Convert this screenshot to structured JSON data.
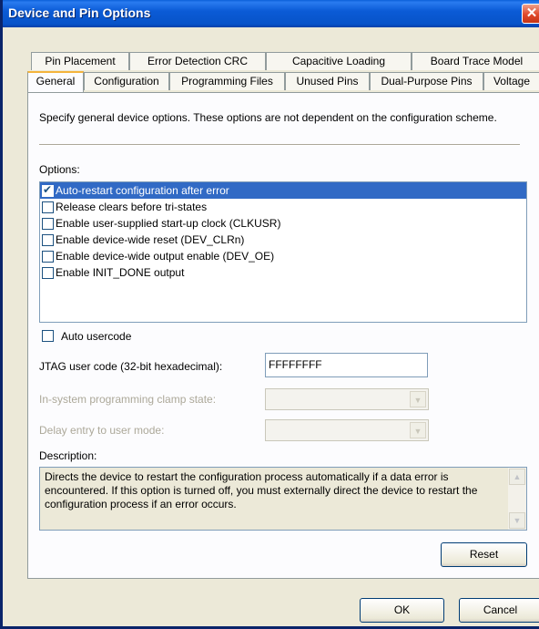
{
  "window": {
    "title": "Device and Pin Options",
    "close_glyph": "✕"
  },
  "tabs_back": [
    "Pin Placement",
    "Error Detection CRC",
    "Capacitive Loading",
    "Board Trace Model"
  ],
  "tabs_front": [
    "General",
    "Configuration",
    "Programming Files",
    "Unused Pins",
    "Dual-Purpose Pins",
    "Voltage"
  ],
  "active_tab": "General",
  "general": {
    "intro": "Specify general device options. These options are not dependent on the configuration scheme.",
    "options_label": "Options:",
    "options": [
      {
        "label": "Auto-restart configuration after error",
        "checked": true,
        "selected": true
      },
      {
        "label": "Release clears before tri-states",
        "checked": false,
        "selected": false
      },
      {
        "label": "Enable user-supplied start-up clock (CLKUSR)",
        "checked": false,
        "selected": false
      },
      {
        "label": "Enable device-wide reset (DEV_CLRn)",
        "checked": false,
        "selected": false
      },
      {
        "label": "Enable device-wide output enable (DEV_OE)",
        "checked": false,
        "selected": false
      },
      {
        "label": "Enable INIT_DONE output",
        "checked": false,
        "selected": false
      }
    ],
    "auto_usercode_label": "Auto usercode",
    "auto_usercode_checked": false,
    "jtag_label": "JTAG user code (32-bit hexadecimal):",
    "jtag_value": "FFFFFFFF",
    "isp_clamp_label": "In-system programming clamp state:",
    "isp_clamp_value": "",
    "delay_entry_label": "Delay entry to user mode:",
    "delay_entry_value": "",
    "description_label": "Description:",
    "description": "Directs the device to restart the configuration process automatically if a data error is encountered. If this option is turned off, you must externally direct the device to restart the configuration process if an error occurs.",
    "reset_label": "Reset"
  },
  "footer": {
    "ok_label": "OK",
    "cancel_label": "Cancel"
  },
  "colors": {
    "title_bar": "#0b5bd6",
    "selection": "#316ac5",
    "face": "#ece9d8",
    "active_tab_accent": "#f4b43c"
  }
}
